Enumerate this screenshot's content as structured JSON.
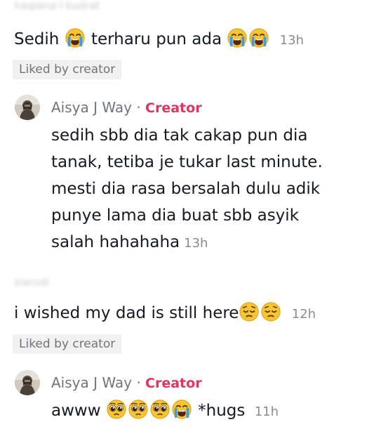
{
  "comment1": {
    "username": "haqiana·i·kudrat",
    "text_part1": "Sedih",
    "text_part2": "terharu pun ada",
    "time": "13h",
    "liked_label": "Liked by creator",
    "emoji_1": "loudly-crying-face-icon",
    "emoji_2": "loudly-crying-face-icon",
    "emoji_3": "loudly-crying-face-icon"
  },
  "reply1": {
    "username": "Aisya J Way",
    "separator": "·",
    "badge": "Creator",
    "lines": [
      "sedih sbb dia tak cakap pun dia",
      "tanak, tetiba je tukar last minute.",
      "mesti dia rasa bersalah dulu adik",
      "punye lama dia buat sbb asyik",
      "salah hahahaha"
    ],
    "time": "13h"
  },
  "comment2": {
    "username": "ziarudi",
    "text": "i wished my dad is still here",
    "time": "12h",
    "liked_label": "Liked by creator",
    "emoji_1": "pensive-face-icon",
    "emoji_2": "pensive-face-icon"
  },
  "reply2": {
    "username": "Aisya J Way",
    "separator": "·",
    "badge": "Creator",
    "text_part1": "awww",
    "text_part2": "*hugs",
    "time": "11h",
    "emojis": [
      "pleading-face-icon",
      "pleading-face-icon",
      "pleading-face-icon",
      "loudly-crying-face-icon"
    ]
  },
  "colors": {
    "text": "#161823",
    "muted": "#73747b",
    "time": "#8a8b91",
    "creator_badge": "#e2345e",
    "chip_bg": "#f1f1f2",
    "emoji_yellow": "#f7c531",
    "tear_blue": "#3b9be8"
  }
}
